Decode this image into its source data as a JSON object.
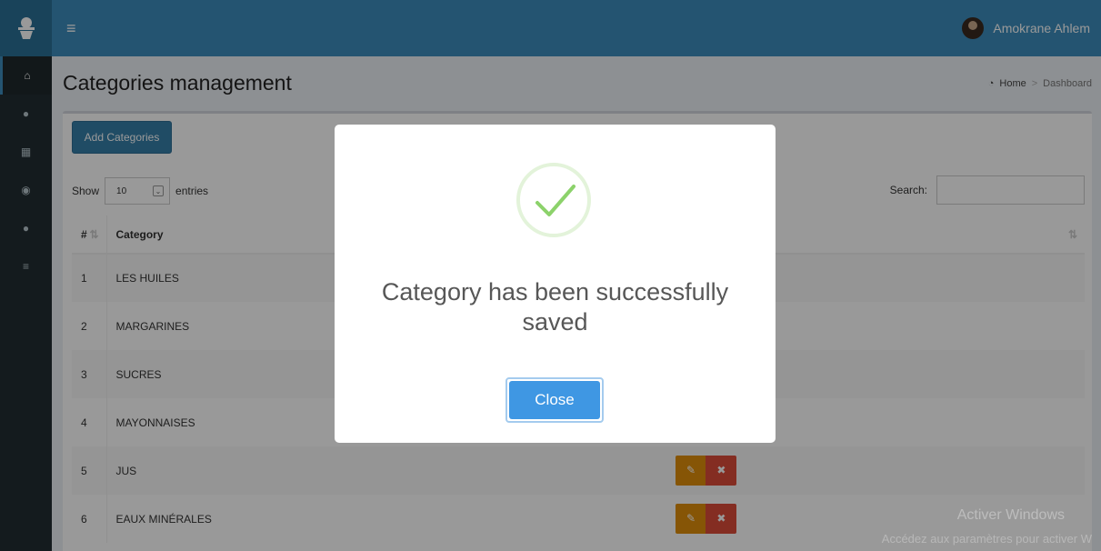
{
  "header": {
    "user_name": "Amokrane Ahlem"
  },
  "sidebar": {
    "items": [
      {
        "icon": "home-icon",
        "glyph": "⌂"
      },
      {
        "icon": "user-icon",
        "glyph": "●"
      },
      {
        "icon": "grid-icon",
        "glyph": "▦"
      },
      {
        "icon": "product-icon",
        "glyph": "◉"
      },
      {
        "icon": "user-icon",
        "glyph": "●"
      },
      {
        "icon": "list-icon",
        "glyph": "≡"
      }
    ]
  },
  "page": {
    "title": "Categories management",
    "breadcrumb_home": "Home",
    "breadcrumb_current": "Dashboard"
  },
  "toolbar": {
    "add_label": "Add Categories"
  },
  "table_controls": {
    "show_label": "Show",
    "entries_value": "10",
    "entries_label": "entries",
    "search_label": "Search:"
  },
  "table": {
    "headers": [
      "#",
      "Category"
    ],
    "rows": [
      {
        "num": "1",
        "category": "LES HUILES"
      },
      {
        "num": "2",
        "category": "MARGARINES"
      },
      {
        "num": "3",
        "category": "SUCRES"
      },
      {
        "num": "4",
        "category": "MAYONNAISES"
      },
      {
        "num": "5",
        "category": "JUS"
      },
      {
        "num": "6",
        "category": "EAUX MINÉRALES"
      }
    ]
  },
  "modal": {
    "message_line1": "Category has been successfully",
    "message_line2": "saved",
    "close_label": "Close"
  },
  "watermark": {
    "line1": "Activer Windows",
    "line2": "Accédez aux paramètres pour activer W"
  }
}
